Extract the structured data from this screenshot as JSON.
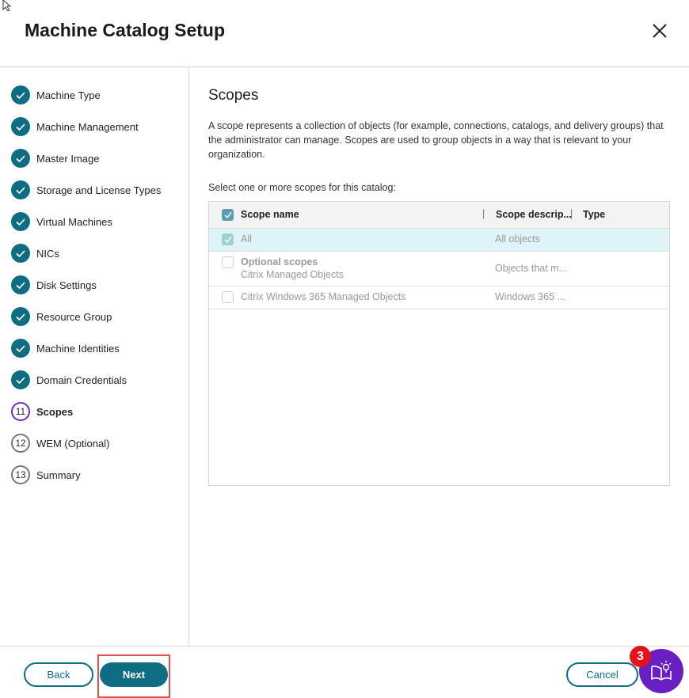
{
  "header": {
    "title": "Machine Catalog Setup"
  },
  "steps": [
    {
      "label": "Machine Type",
      "state": "done"
    },
    {
      "label": "Machine Management",
      "state": "done"
    },
    {
      "label": "Master Image",
      "state": "done"
    },
    {
      "label": "Storage and License Types",
      "state": "done"
    },
    {
      "label": "Virtual Machines",
      "state": "done"
    },
    {
      "label": "NICs",
      "state": "done"
    },
    {
      "label": "Disk Settings",
      "state": "done"
    },
    {
      "label": "Resource Group",
      "state": "done"
    },
    {
      "label": "Machine Identities",
      "state": "done"
    },
    {
      "label": "Domain Credentials",
      "state": "done"
    },
    {
      "label": "Scopes",
      "state": "current",
      "number": "11"
    },
    {
      "label": "WEM (Optional)",
      "state": "todo",
      "number": "12"
    },
    {
      "label": "Summary",
      "state": "todo",
      "number": "13"
    }
  ],
  "main": {
    "heading": "Scopes",
    "description": "A scope represents a collection of objects (for example, connections, catalogs, and delivery groups) that the administrator can manage. Scopes are used to group objects in a way that is relevant to your organization.",
    "select_label": "Select one or more scopes for this catalog:",
    "table": {
      "columns": [
        "Scope name",
        "Scope descrip...",
        "Type"
      ],
      "rows": [
        {
          "name": "All",
          "subname": "",
          "description": "All objects",
          "type": "",
          "checked": true
        },
        {
          "name": "Optional scopes",
          "subname": "Citrix Managed Objects",
          "description": "Objects that m...",
          "type": "",
          "checked": false
        },
        {
          "name": "Citrix Windows 365 Managed Objects",
          "subname": "",
          "description": "Windows 365 ...",
          "type": "",
          "checked": false
        }
      ]
    }
  },
  "footer": {
    "back": "Back",
    "next": "Next",
    "cancel": "Cancel",
    "help_badge": "3"
  },
  "colors": {
    "accent": "#0e6d83",
    "current": "#6a2ec0",
    "help": "#6a1fc2",
    "badge": "#e5121b"
  }
}
